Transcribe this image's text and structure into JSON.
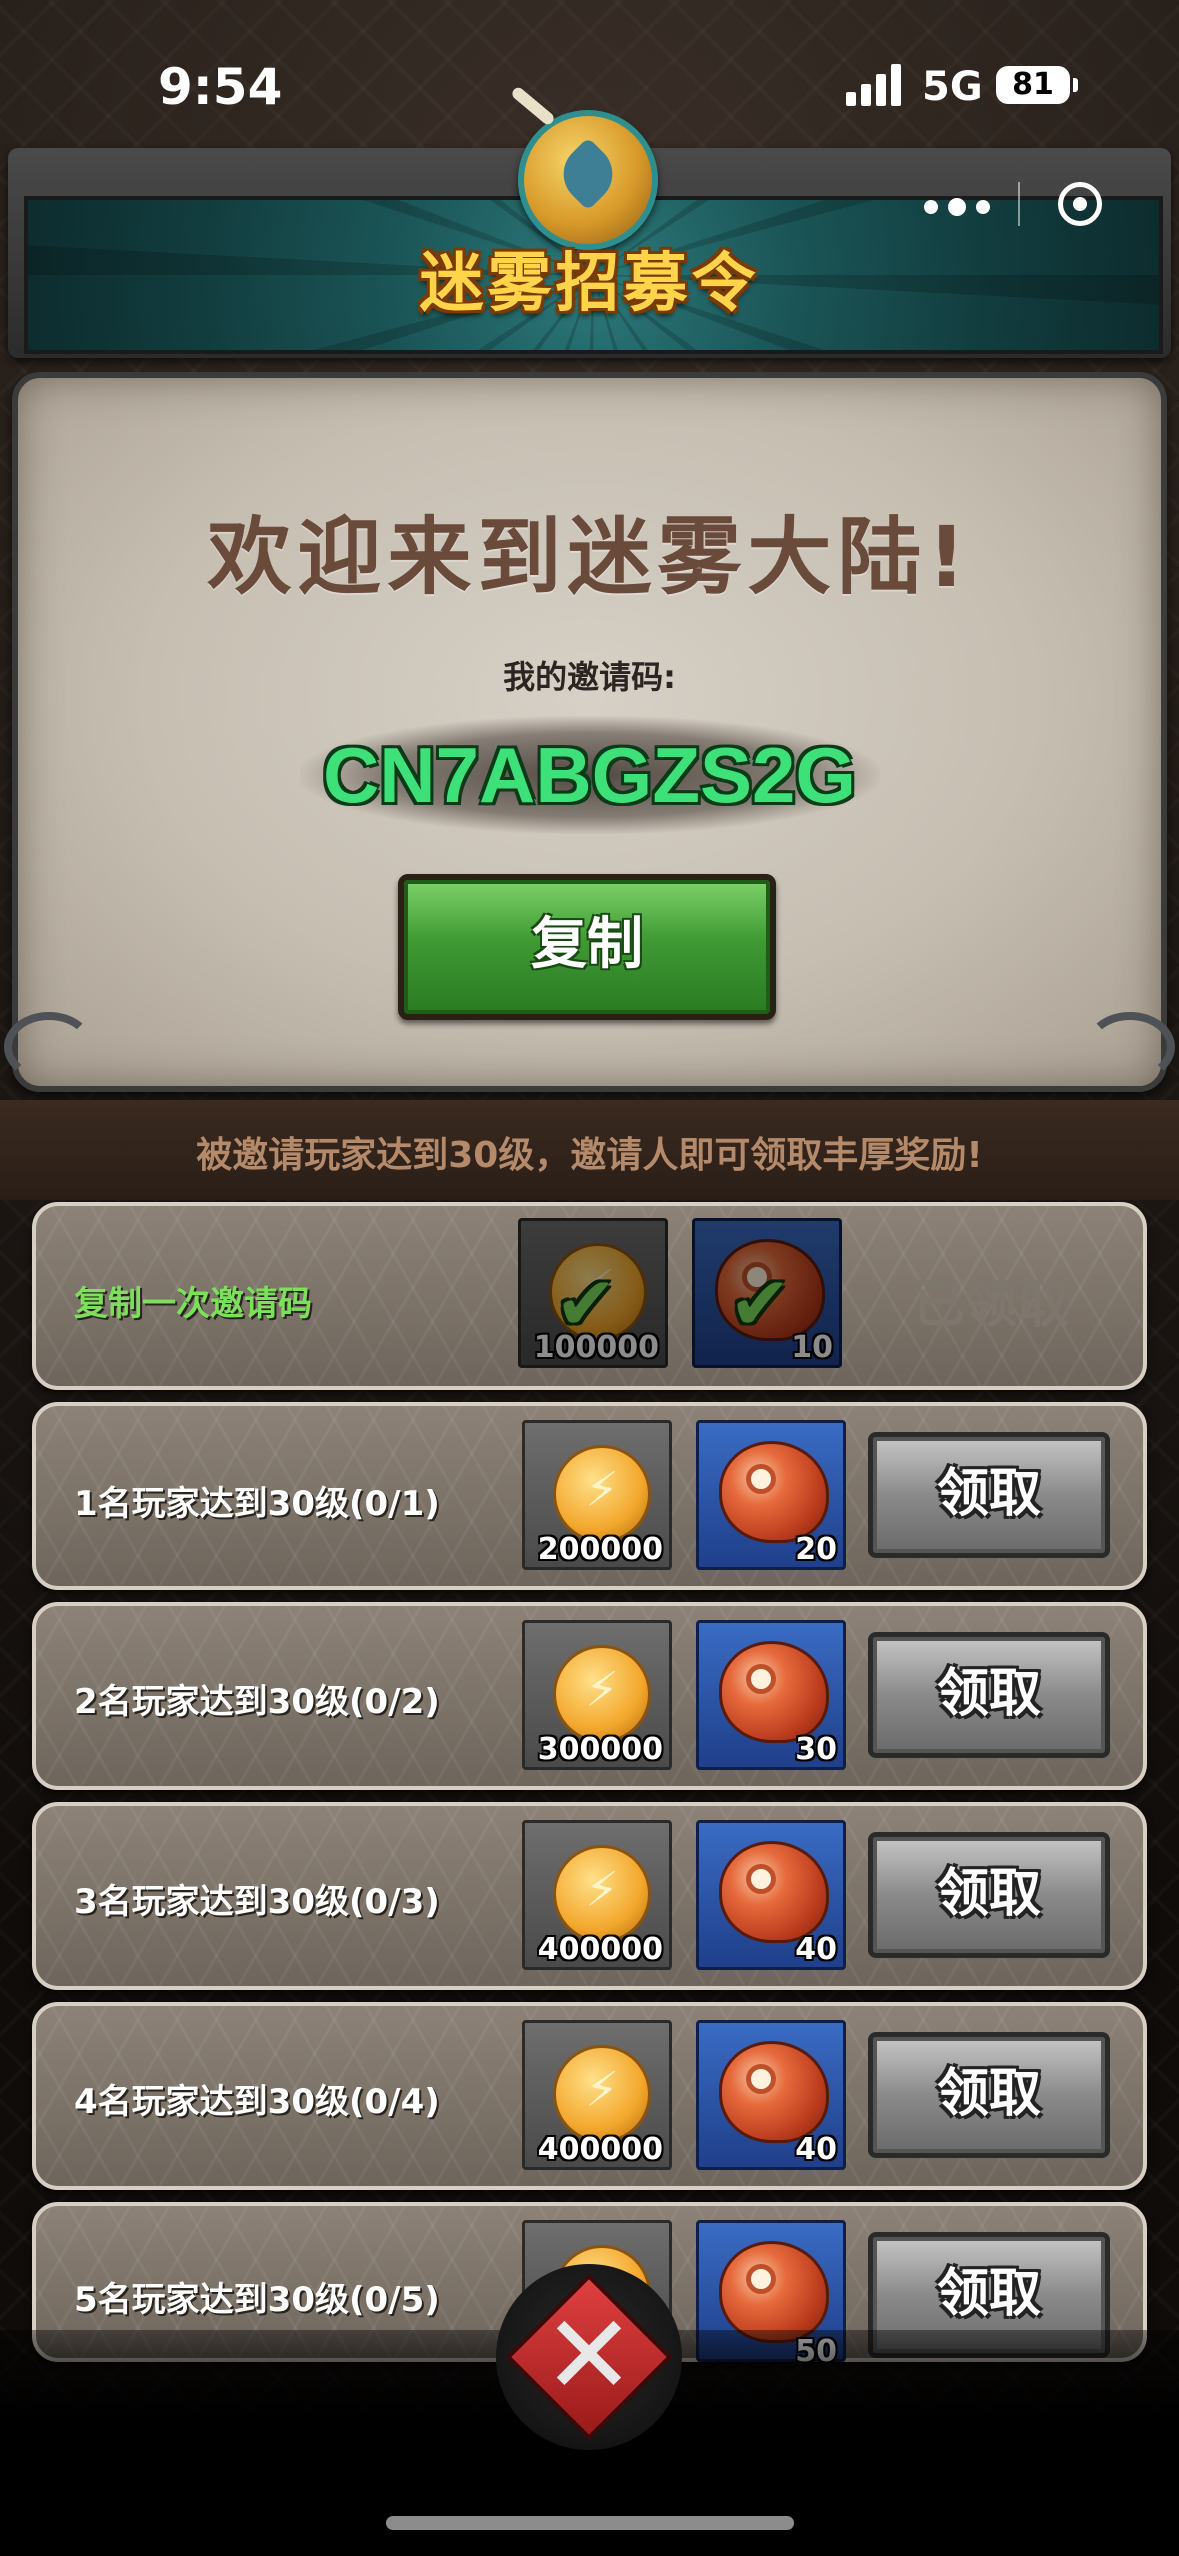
{
  "status": {
    "time": "9:54",
    "network": "5G",
    "battery": "81"
  },
  "header": {
    "title": "迷雾招募令"
  },
  "welcome": {
    "heading": "欢迎来到迷雾大陆!",
    "code_label": "我的邀请码:",
    "code": "CN7ABGZS2G",
    "copy_label": "复制"
  },
  "info": {
    "text": "被邀请玩家达到30级，邀请人即可领取丰厚奖励!"
  },
  "rewards": [
    {
      "label": "复制一次邀请码",
      "coins": "100000",
      "meat": "10",
      "status": "已领取"
    },
    {
      "label": "1名玩家达到30级(0/1)",
      "coins": "200000",
      "meat": "20",
      "status": "领取"
    },
    {
      "label": "2名玩家达到30级(0/2)",
      "coins": "300000",
      "meat": "30",
      "status": "领取"
    },
    {
      "label": "3名玩家达到30级(0/3)",
      "coins": "400000",
      "meat": "40",
      "status": "领取"
    },
    {
      "label": "4名玩家达到30级(0/4)",
      "coins": "400000",
      "meat": "40",
      "status": "领取"
    },
    {
      "label": "5名玩家达到30级(0/5)",
      "coins": "",
      "meat": "50",
      "status": "领取"
    }
  ],
  "colors": {
    "code_green": "#3ee07a",
    "title_gold": "#ffd34a",
    "claimed_label_green": "#7de05a"
  }
}
